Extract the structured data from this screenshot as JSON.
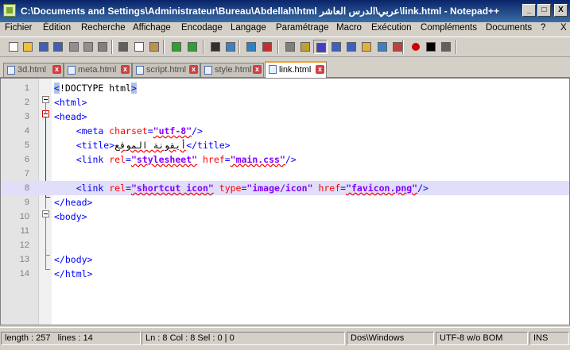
{
  "window": {
    "title": "C:\\Documents and Settings\\Administrateur\\Bureau\\Abdellah\\html عربي\\الدرس العاشر\\link.html - Notepad++"
  },
  "window_controls": {
    "minimize": "_",
    "maximize": "□",
    "close": "X"
  },
  "menu": [
    "Fichier",
    "Édition",
    "Recherche",
    "Affichage",
    "Encodage",
    "Langage",
    "Paramétrage",
    "Macro",
    "Exécution",
    "Compléments",
    "Documents",
    "?"
  ],
  "menu_close": "X",
  "toolbar": [
    {
      "name": "new-file-icon",
      "color": "#ffffff"
    },
    {
      "name": "open-file-icon",
      "color": "#f0c040"
    },
    {
      "name": "save-icon",
      "color": "#4060b0"
    },
    {
      "name": "save-all-icon",
      "color": "#4060b0"
    },
    {
      "name": "close-icon",
      "color": "#909090"
    },
    {
      "name": "close-all-icon",
      "color": "#909090"
    },
    {
      "name": "print-icon",
      "color": "#808080"
    },
    {
      "name": "cut-icon",
      "color": "#606060"
    },
    {
      "name": "copy-icon",
      "color": "#ffffff"
    },
    {
      "name": "paste-icon",
      "color": "#c09050"
    },
    {
      "name": "undo-icon",
      "color": "#30a030"
    },
    {
      "name": "redo-icon",
      "color": "#30a030"
    },
    {
      "name": "find-icon",
      "color": "#303030"
    },
    {
      "name": "replace-icon",
      "color": "#4080c0"
    },
    {
      "name": "zoom-in-icon",
      "color": "#3080c0"
    },
    {
      "name": "zoom-out-icon",
      "color": "#c03030"
    },
    {
      "name": "sync-scroll-v-icon",
      "color": "#808080"
    },
    {
      "name": "sync-scroll-h-icon",
      "color": "#c0a030"
    },
    {
      "name": "word-wrap-icon",
      "color": "#4040c0"
    },
    {
      "name": "show-all-chars-icon",
      "color": "#4060c0"
    },
    {
      "name": "indent-guide-icon",
      "color": "#4060c0"
    },
    {
      "name": "user-lang-icon",
      "color": "#e0b040"
    },
    {
      "name": "doc-map-icon",
      "color": "#4080c0"
    },
    {
      "name": "function-list-icon",
      "color": "#c04040"
    },
    {
      "name": "record-macro-icon",
      "color": "#cc0000"
    },
    {
      "name": "stop-macro-icon",
      "color": "#000000"
    },
    {
      "name": "play-macro-icon",
      "color": "#606060"
    }
  ],
  "tabs": [
    {
      "label": "3d.html",
      "active": false
    },
    {
      "label": "meta.html",
      "active": false
    },
    {
      "label": "script.html",
      "active": false
    },
    {
      "label": "style.html",
      "active": false
    },
    {
      "label": "link.html",
      "active": true
    }
  ],
  "editor": {
    "current_line": 8,
    "lines": [
      {
        "n": "1",
        "tokens": [
          {
            "t": "<",
            "c": "t-tag brace"
          },
          {
            "t": "!DOCTYPE html",
            "c": "t-dt"
          },
          {
            "t": ">",
            "c": "t-tag brace"
          }
        ]
      },
      {
        "n": "2",
        "tokens": [
          {
            "t": "<html>",
            "c": "t-tag"
          }
        ]
      },
      {
        "n": "3",
        "tokens": [
          {
            "t": "<head>",
            "c": "t-tag"
          }
        ]
      },
      {
        "n": "4",
        "tokens": [
          {
            "t": "    <meta ",
            "c": "t-tag"
          },
          {
            "t": "charset",
            "c": "t-attr"
          },
          {
            "t": "=",
            "c": "t-tag"
          },
          {
            "t": "\"utf-8\"",
            "c": "t-val sq"
          },
          {
            "t": "/>",
            "c": "t-tag"
          }
        ]
      },
      {
        "n": "5",
        "tokens": [
          {
            "t": "    <title>",
            "c": "t-tag"
          },
          {
            "t": "أيقونة الموقع",
            "c": "t-txt sq"
          },
          {
            "t": "</title>",
            "c": "t-tag"
          }
        ]
      },
      {
        "n": "6",
        "tokens": [
          {
            "t": "    <link ",
            "c": "t-tag"
          },
          {
            "t": "rel",
            "c": "t-attr"
          },
          {
            "t": "=",
            "c": "t-tag"
          },
          {
            "t": "\"stylesheet\"",
            "c": "t-val sq"
          },
          {
            "t": " ",
            "c": "t-tag"
          },
          {
            "t": "href",
            "c": "t-attr"
          },
          {
            "t": "=",
            "c": "t-tag"
          },
          {
            "t": "\"main.css\"",
            "c": "t-val sq"
          },
          {
            "t": "/>",
            "c": "t-tag"
          }
        ]
      },
      {
        "n": "7",
        "tokens": []
      },
      {
        "n": "8",
        "tokens": [
          {
            "t": "    <link ",
            "c": "t-tag"
          },
          {
            "t": "rel",
            "c": "t-attr"
          },
          {
            "t": "=",
            "c": "t-tag"
          },
          {
            "t": "\"shortcut icon\"",
            "c": "t-val sq"
          },
          {
            "t": " ",
            "c": "t-tag"
          },
          {
            "t": "type",
            "c": "t-attr"
          },
          {
            "t": "=",
            "c": "t-tag"
          },
          {
            "t": "\"image/icon\"",
            "c": "t-val"
          },
          {
            "t": " ",
            "c": "t-tag"
          },
          {
            "t": "href",
            "c": "t-attr"
          },
          {
            "t": "=",
            "c": "t-tag"
          },
          {
            "t": "\"favicon.png\"",
            "c": "t-val sq"
          },
          {
            "t": "/>",
            "c": "t-tag"
          }
        ]
      },
      {
        "n": "9",
        "tokens": [
          {
            "t": "</head>",
            "c": "t-tag"
          }
        ]
      },
      {
        "n": "10",
        "tokens": [
          {
            "t": "<body>",
            "c": "t-tag"
          }
        ]
      },
      {
        "n": "11",
        "tokens": []
      },
      {
        "n": "12",
        "tokens": []
      },
      {
        "n": "13",
        "tokens": [
          {
            "t": "</body>",
            "c": "t-tag"
          }
        ]
      },
      {
        "n": "14",
        "tokens": [
          {
            "t": "</html>",
            "c": "t-tag"
          }
        ]
      }
    ]
  },
  "status": {
    "length": "length : 257",
    "lines": "lines : 14",
    "position": "Ln : 8    Col : 8    Sel : 0 | 0",
    "eol": "Dos\\Windows",
    "encoding": "UTF-8 w/o BOM",
    "mode": "INS"
  }
}
